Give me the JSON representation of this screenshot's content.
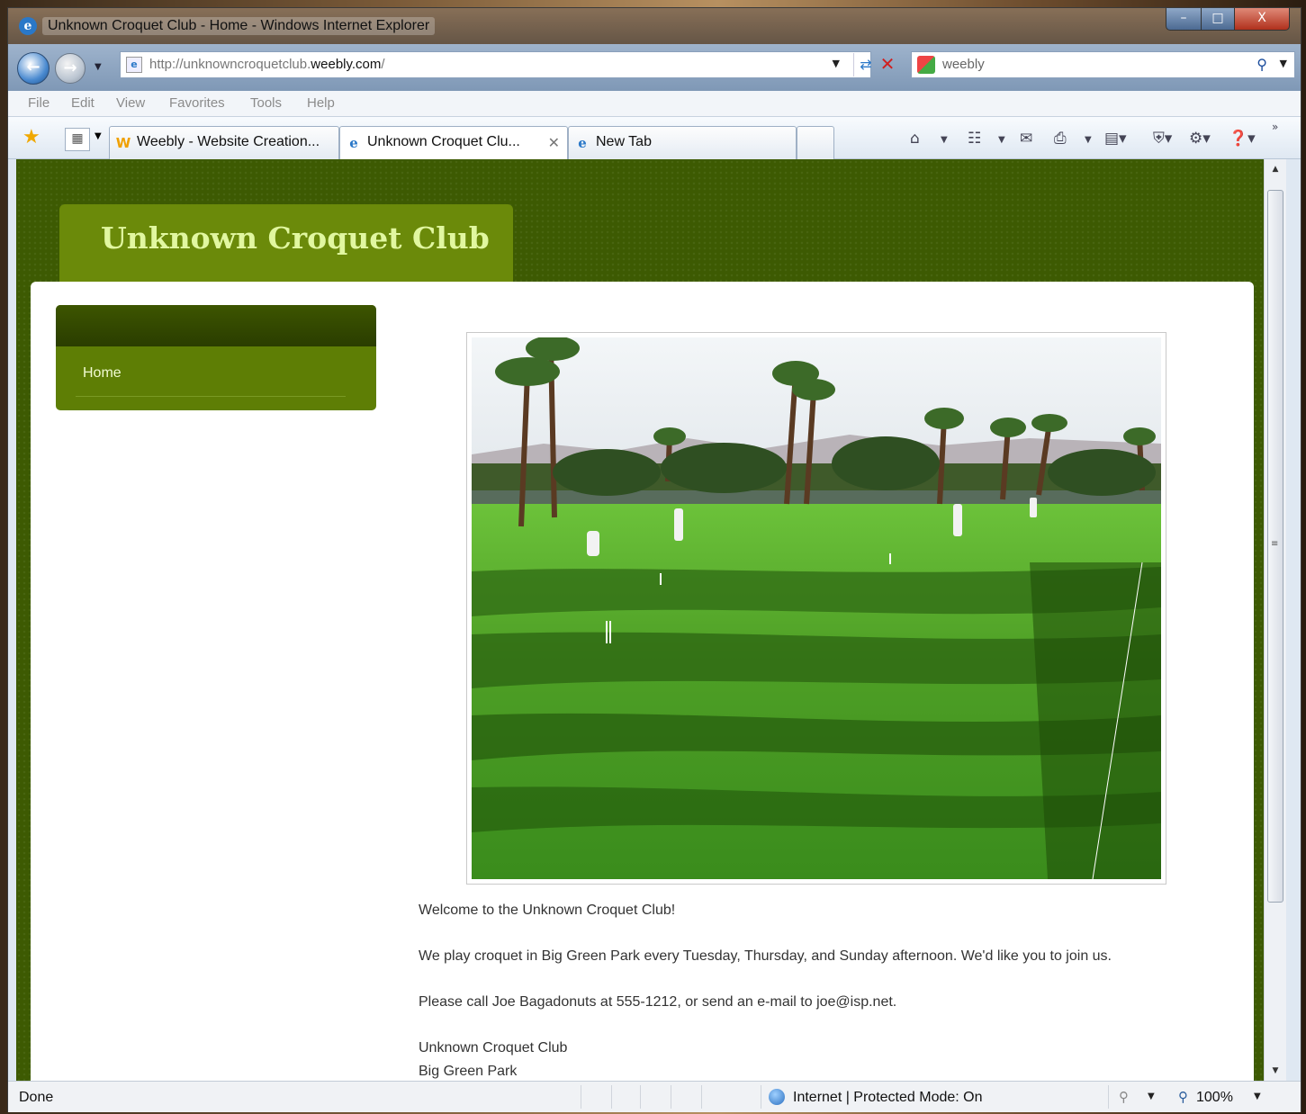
{
  "window": {
    "title": "Unknown Croquet Club - Home - Windows Internet Explorer",
    "minimize": "–",
    "maximize": "□",
    "close": "X"
  },
  "address_bar": {
    "url_prefix": "http://unknowncroquetclub.",
    "url_domain": "weebly.com",
    "url_suffix": "/",
    "search_text": "weebly"
  },
  "menu": [
    "File",
    "Edit",
    "View",
    "Favorites",
    "Tools",
    "Help"
  ],
  "tabs": [
    {
      "label": "Weebly - Website Creation...",
      "active": false
    },
    {
      "label": "Unknown Croquet Clu...",
      "active": true
    },
    {
      "label": "New Tab",
      "active": false
    }
  ],
  "page": {
    "site_title": "Unknown Croquet Club",
    "nav": [
      {
        "label": "Home"
      }
    ],
    "paragraphs": [
      "Welcome to the Unknown Croquet Club!",
      "We play croquet in Big Green Park every Tuesday, Thursday, and Sunday afternoon.  We'd like you to join us.",
      "Please call Joe Bagadonuts at 555-1212, or send an e-mail to joe@isp.net.",
      "Unknown Croquet Club",
      "Big Green Park"
    ],
    "colors": {
      "background": "#3d5a02",
      "title_box": "#6b8a0a",
      "title_text": "#e1f7a0",
      "nav_bg": "#5e7e05"
    }
  },
  "status_bar": {
    "status": "Done",
    "zone": "Internet | Protected Mode: On",
    "zoom": "100%"
  }
}
